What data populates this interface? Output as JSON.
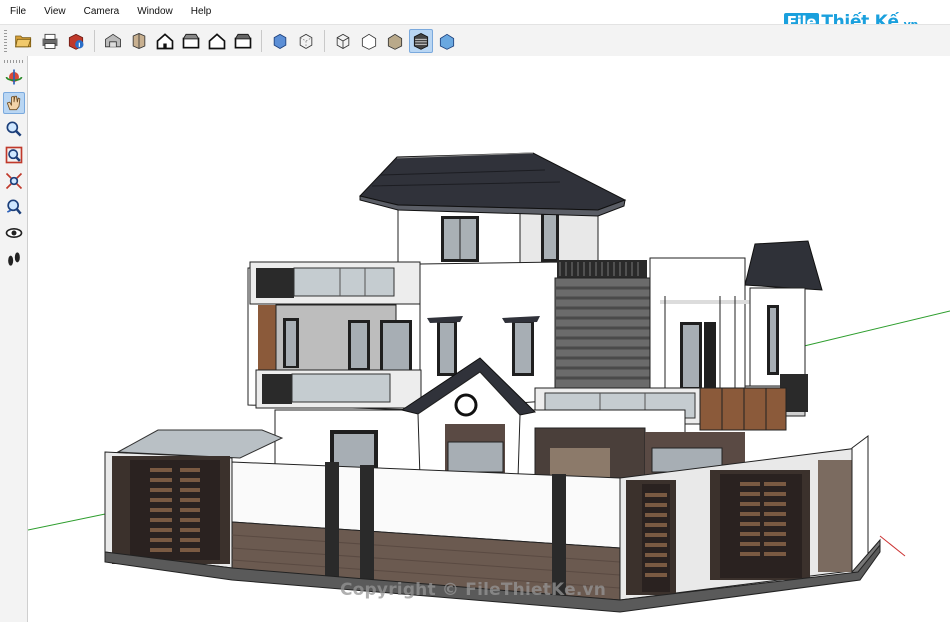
{
  "menu": [
    "File",
    "View",
    "Camera",
    "Window",
    "Help"
  ],
  "logo": {
    "box": "File",
    "main": "Thiết Kế",
    "suffix": ".vn"
  },
  "toolbar_icons": [
    {
      "name": "open-folder-icon"
    },
    {
      "name": "print-icon"
    },
    {
      "name": "model-info-icon"
    },
    {
      "sep": true
    },
    {
      "name": "iso-view-icon"
    },
    {
      "name": "top-view-icon"
    },
    {
      "name": "front-view-icon"
    },
    {
      "name": "right-view-icon"
    },
    {
      "name": "back-view-icon"
    },
    {
      "name": "left-view-icon"
    },
    {
      "sep": true
    },
    {
      "name": "xray-icon"
    },
    {
      "name": "back-edges-icon"
    },
    {
      "sep": true
    },
    {
      "name": "wireframe-icon"
    },
    {
      "name": "hidden-line-icon"
    },
    {
      "name": "shaded-icon"
    },
    {
      "name": "shaded-textures-icon",
      "active": true
    },
    {
      "name": "monochrome-icon"
    }
  ],
  "left_tools": [
    {
      "name": "orbit-icon"
    },
    {
      "name": "pan-icon",
      "active": true
    },
    {
      "name": "zoom-icon"
    },
    {
      "name": "zoom-window-icon"
    },
    {
      "name": "zoom-extents-icon"
    },
    {
      "name": "previous-view-icon"
    },
    {
      "name": "look-around-icon"
    },
    {
      "name": "walk-icon"
    }
  ],
  "watermark": "Copyright © FileThietKe.vn",
  "colors": {
    "accent": "#1aa0dd",
    "toolbar_bg": "#f3f3f3",
    "active": "#b9d6f3"
  }
}
